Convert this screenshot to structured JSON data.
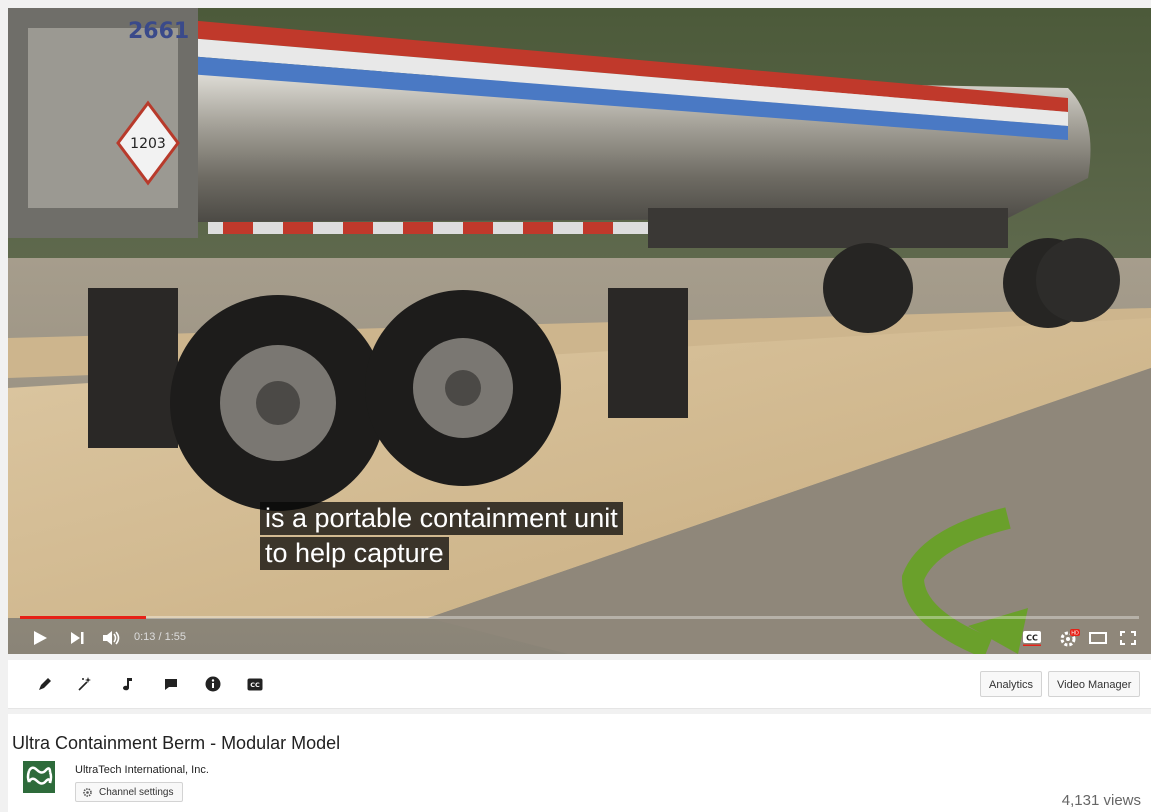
{
  "player": {
    "captions": [
      "is a portable containment unit",
      "to help capture"
    ],
    "time_display": "0:13 / 1:55",
    "progress_fraction": 0.113,
    "truck_number": "1203",
    "cab_number": "2661",
    "accent_color": "#e62117",
    "annotation_arrow_color": "#6aa02b"
  },
  "toolbar": {
    "icons": [
      "edit-pencil-icon",
      "enhancements-wand-icon",
      "audio-note-icon",
      "annotations-speech-icon",
      "info-icon",
      "cc-icon"
    ],
    "analytics_label": "Analytics",
    "video_manager_label": "Video Manager"
  },
  "video": {
    "title": "Ultra Containment Berm - Modular Model",
    "channel": "UltraTech International, Inc.",
    "channel_settings_label": "Channel settings",
    "views": "4,131 views"
  }
}
